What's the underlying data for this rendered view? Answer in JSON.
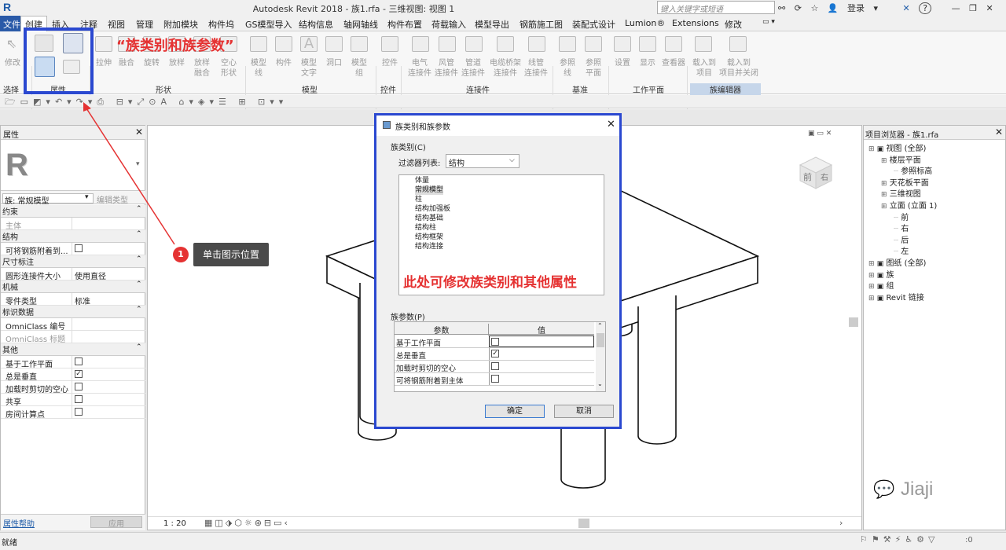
{
  "titlebar": {
    "logo": "R",
    "title": "Autodesk Revit 2018 -   族1.rfa - 三维视图: 视图 1",
    "search_placeholder": "键入关键字或短语",
    "login": "登录",
    "help": "?"
  },
  "menu_tabs": [
    "文件",
    "创建",
    "插入",
    "注释",
    "视图",
    "管理",
    "附加模块",
    "构件坞",
    "GS模型导入",
    "结构信息",
    "轴网轴线",
    "构件布置",
    "荷载输入",
    "模型导出",
    "钢筋施工图",
    "装配式设计",
    "Lumion®",
    "Extensions",
    "修改"
  ],
  "ribbon": {
    "groups": [
      "选择",
      "属性",
      "形状",
      "模型",
      "控件",
      "连接件",
      "基准",
      "工作平面",
      "族编辑器"
    ],
    "select_label": "修改",
    "tools": [
      {
        "label": "拉伸"
      },
      {
        "label": "融合"
      },
      {
        "label": "旋转"
      },
      {
        "label": "放样"
      },
      {
        "label": "放样\n融合"
      },
      {
        "label": "空心\n形状"
      },
      {
        "label": "模型\n线"
      },
      {
        "label": "构件"
      },
      {
        "label": "模型\n文字"
      },
      {
        "label": "洞口"
      },
      {
        "label": "模型\n组"
      },
      {
        "label": "控件"
      },
      {
        "label": "电气\n连接件"
      },
      {
        "label": "风管\n连接件"
      },
      {
        "label": "管道\n连接件"
      },
      {
        "label": "电缆桥架\n连接件"
      },
      {
        "label": "线管\n连接件"
      },
      {
        "label": "参照\n线"
      },
      {
        "label": "参照\n平面"
      },
      {
        "label": "设置"
      },
      {
        "label": "显示"
      },
      {
        "label": "查看器"
      },
      {
        "label": "载入到\n项目"
      },
      {
        "label": "载入到\n项目并关闭"
      }
    ]
  },
  "properties": {
    "title": "属性",
    "type_selector": "族: 常规模型",
    "edit_type": "编辑类型",
    "help_link": "属性帮助",
    "apply": "应用",
    "sections": [
      {
        "header": "约束",
        "rows": [
          {
            "k": "主体",
            "v": "",
            "dim": true
          }
        ]
      },
      {
        "header": "结构",
        "rows": [
          {
            "k": "可将钢筋附着到...",
            "checkbox": false
          }
        ]
      },
      {
        "header": "尺寸标注",
        "rows": [
          {
            "k": "圆形连接件大小",
            "v": "使用直径"
          }
        ]
      },
      {
        "header": "机械",
        "rows": [
          {
            "k": "零件类型",
            "v": "标准"
          }
        ]
      },
      {
        "header": "标识数据",
        "rows": [
          {
            "k": "OmniClass 编号",
            "v": ""
          },
          {
            "k": "OmniClass 标题",
            "v": "",
            "dim": true
          }
        ]
      },
      {
        "header": "其他",
        "rows": [
          {
            "k": "基于工作平面",
            "checkbox": false
          },
          {
            "k": "总是垂直",
            "checkbox": true
          },
          {
            "k": "加载时剪切的空心",
            "checkbox": false
          },
          {
            "k": "共享",
            "checkbox": false
          },
          {
            "k": "房间计算点",
            "checkbox": false
          }
        ]
      }
    ]
  },
  "viewcube": {
    "front": "前",
    "right": "右"
  },
  "view_controls": {
    "scale": "1 : 20"
  },
  "project_browser": {
    "title": "项目浏览器 - 族1.rfa",
    "nodes": [
      {
        "label": "视图 (全部)",
        "level": 0
      },
      {
        "label": "楼层平面",
        "level": 1
      },
      {
        "label": "参照标高",
        "level": 2
      },
      {
        "label": "天花板平面",
        "level": 1
      },
      {
        "label": "三维视图",
        "level": 1
      },
      {
        "label": "立面 (立面 1)",
        "level": 1
      },
      {
        "label": "前",
        "level": 2
      },
      {
        "label": "右",
        "level": 2
      },
      {
        "label": "后",
        "level": 2
      },
      {
        "label": "左",
        "level": 2
      },
      {
        "label": "图纸 (全部)",
        "level": 0
      },
      {
        "label": "族",
        "level": 0
      },
      {
        "label": "组",
        "level": 0
      },
      {
        "label": "Revit 链接",
        "level": 0
      }
    ]
  },
  "dialog": {
    "title": "族类别和族参数",
    "category_section": "族类别(C)",
    "filter_label": "过滤器列表:",
    "filter_value": "结构",
    "categories": [
      "体量",
      "常规模型",
      "柱",
      "结构加强板",
      "结构基础",
      "结构柱",
      "结构框架",
      "结构连接"
    ],
    "selected_category": "常规模型",
    "overlay_note": "此处可修改族类别和其他属性",
    "params_section": "族参数(P)",
    "param_header": "参数",
    "value_header": "值",
    "params": [
      {
        "name": "基于工作平面",
        "checked": false
      },
      {
        "name": "总是垂直",
        "checked": true
      },
      {
        "name": "加载时剪切的空心",
        "checked": false
      },
      {
        "name": "可将钢筋附着到主体",
        "checked": false
      }
    ],
    "ok": "确定",
    "cancel": "取消"
  },
  "annotations": {
    "label": "“族类别和族参数”",
    "step_number": "1",
    "step_text": "单击图示位置"
  },
  "statusbar": {
    "text": "就绪",
    "zoom": ":0"
  },
  "watermark": "Jiaji"
}
